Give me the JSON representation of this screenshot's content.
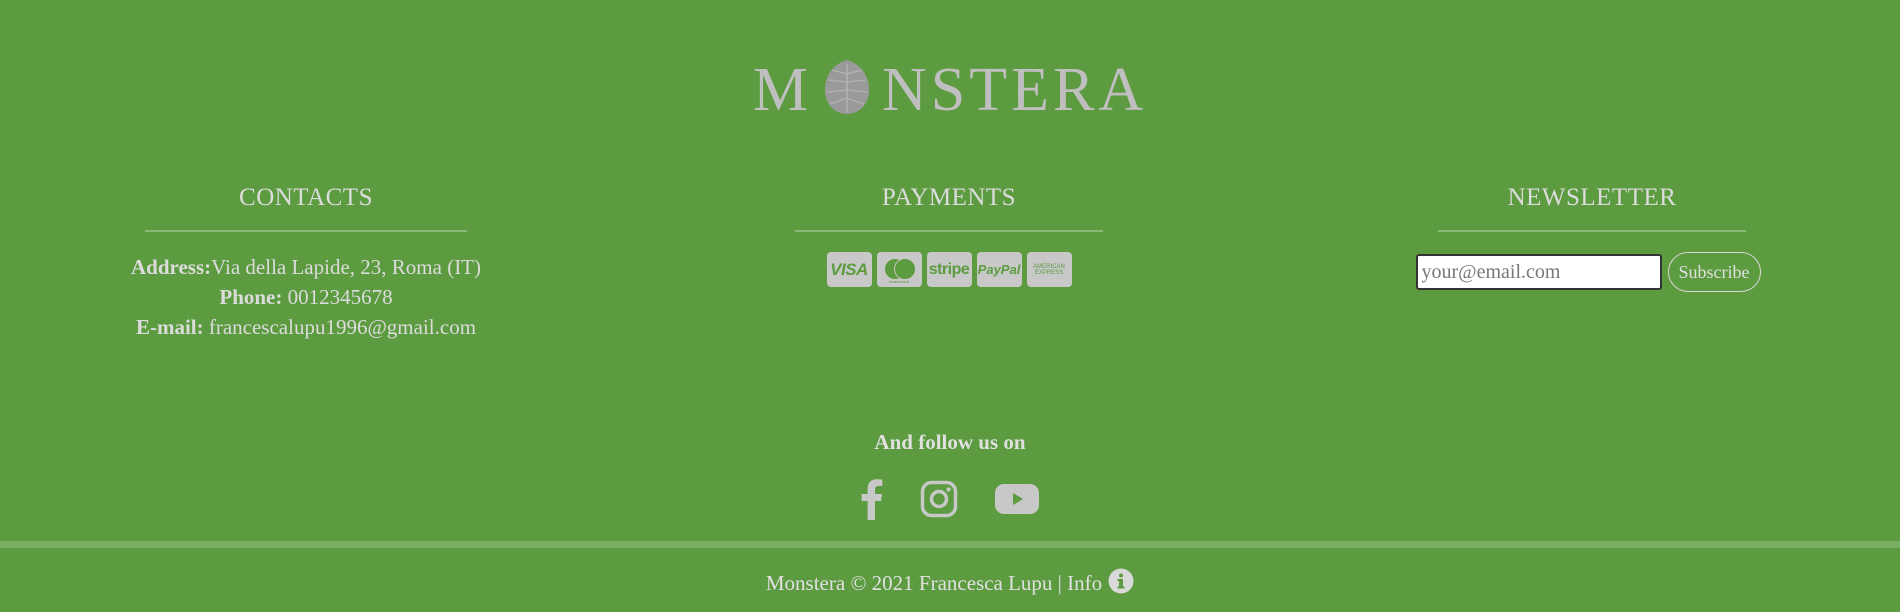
{
  "logo": {
    "text_before": "M",
    "text_after": "NSTERA",
    "icon": "monstera-leaf-icon"
  },
  "contacts": {
    "heading": "CONTACTS",
    "address_label": "Address:",
    "address_value": "Via della Lapide, 23, Roma (IT)",
    "phone_label": "Phone:",
    "phone_value": "0012345678",
    "email_label": "E-mail:",
    "email_value": "francescalupu1996@gmail.com"
  },
  "payments": {
    "heading": "PAYMENTS",
    "cards": [
      {
        "name": "visa-icon",
        "label": "VISA"
      },
      {
        "name": "mastercard-icon",
        "label": "mastercard"
      },
      {
        "name": "stripe-icon",
        "label": "stripe"
      },
      {
        "name": "paypal-icon",
        "label": "PayPal"
      },
      {
        "name": "amex-icon",
        "label": "AMERICAN EXPRESS"
      }
    ]
  },
  "newsletter": {
    "heading": "NEWSLETTER",
    "placeholder": "your@email.com",
    "button_label": "Subscribe"
  },
  "follow": {
    "heading": "And follow us on",
    "icons": [
      "facebook-icon",
      "instagram-icon",
      "youtube-icon"
    ]
  },
  "footer": {
    "copyright": "Monstera © 2021 Francesca Lupu | Info",
    "info_icon": "info-icon"
  },
  "colors": {
    "background": "#5c9b40",
    "text": "#d9d9d9",
    "icon": "#c8c8c8"
  }
}
